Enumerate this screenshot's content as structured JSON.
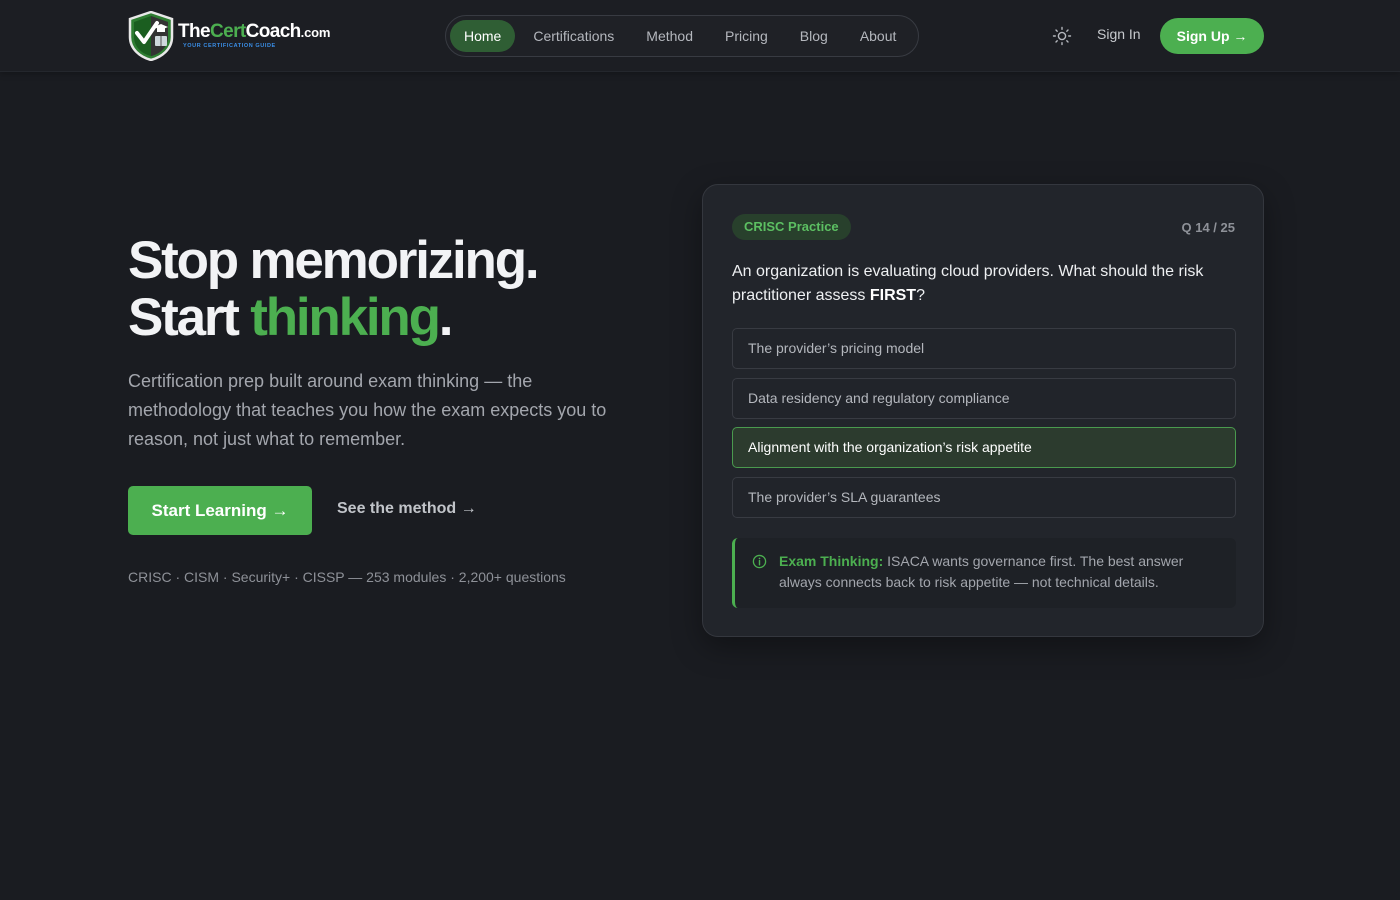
{
  "brand": {
    "name_prefix": "The",
    "name_accent": "Cert",
    "name_suffix": "Coach",
    "domain": ".com",
    "tagline": "YOUR CERTIFICATION GUIDE"
  },
  "nav": {
    "items": [
      {
        "label": "Home",
        "active": true
      },
      {
        "label": "Certifications"
      },
      {
        "label": "Method"
      },
      {
        "label": "Pricing"
      },
      {
        "label": "Blog"
      },
      {
        "label": "About"
      }
    ]
  },
  "header": {
    "theme_icon": "sun-icon",
    "signin_label": "Sign In",
    "signup_label": "Sign Up →"
  },
  "hero": {
    "title_line1": "Stop memorizing.",
    "title_line2_prefix": "Start ",
    "title_line2_accent": "thinking",
    "title_line2_suffix": ".",
    "description": "Certification prep built around exam thinking — the methodology that teaches you how the exam expects you to reason, not just what to remember.",
    "primary_cta": "Start Learning →",
    "secondary_cta": "See the method →",
    "stats": "CRISC · CISM · Security+ · CISSP — 253 modules · 2,200+ questions"
  },
  "practice": {
    "badge": "CRISC Practice",
    "counter": "Q 14 / 25",
    "question_prefix": "An organization is evaluating cloud providers. What should the risk practitioner assess ",
    "question_emphasis": "FIRST",
    "question_suffix": "?",
    "options": [
      {
        "label": "The provider’s pricing model"
      },
      {
        "label": "Data residency and regulatory compliance"
      },
      {
        "label": "Alignment with the organization’s risk appetite",
        "selected": true
      },
      {
        "label": "The provider’s SLA guarantees"
      }
    ],
    "explanation_icon": "info-icon",
    "explanation_label": "Exam Thinking:",
    "explanation_text": " ISACA wants governance first. The best answer always connects back to risk appetite — not technical details."
  },
  "colors": {
    "background": "#1a1c21",
    "accent": "#4caf50",
    "card": "#22252b"
  }
}
